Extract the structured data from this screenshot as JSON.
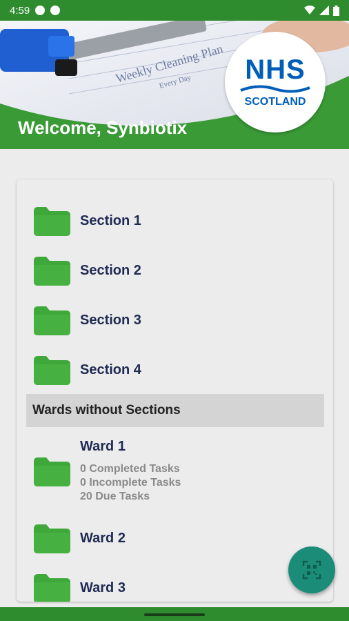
{
  "status_bar": {
    "time": "4:59"
  },
  "header": {
    "welcome": "Welcome, Synbiotix",
    "banner_text_1": "Weekly Cleaning Plan",
    "banner_text_2": "Every Day",
    "logo_main": "NHS",
    "logo_sub": "SCOTLAND"
  },
  "sections": [
    {
      "label": "Section 1"
    },
    {
      "label": "Section 2"
    },
    {
      "label": "Section 3"
    },
    {
      "label": "Section 4"
    }
  ],
  "group_header": "Wards without Sections",
  "wards": [
    {
      "label": "Ward 1",
      "completed": "0 Completed Tasks",
      "incomplete": "0 Incomplete Tasks",
      "due": "20 Due Tasks"
    },
    {
      "label": "Ward 2"
    },
    {
      "label": "Ward 3"
    }
  ],
  "colors": {
    "header_green": "#3a9a36",
    "status_green": "#2e8b2e",
    "folder_green": "#3fa83a",
    "fab_teal": "#1b8c78",
    "nhs_blue": "#005eb8"
  },
  "icons": {
    "fab": "qr-scan-icon",
    "folder": "folder-icon"
  }
}
